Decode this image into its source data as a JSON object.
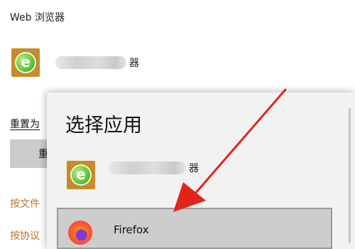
{
  "section_title": "Web 浏览器",
  "default_app": {
    "icon": "ie-green-icon",
    "name_suffix": "器"
  },
  "sidebar": {
    "reset_label": "重置为",
    "reset_button": "重",
    "link_file_type": "按文件",
    "link_protocol": "按协议"
  },
  "dialog": {
    "title": "选择应用",
    "options": [
      {
        "icon": "ie-green-icon",
        "name_suffix": "器"
      },
      {
        "icon": "firefox-icon",
        "name": "Firefox"
      }
    ]
  },
  "colors": {
    "arrow": "#e2231a",
    "link": "#b8712e",
    "selected_bg": "#cdcdcd"
  }
}
